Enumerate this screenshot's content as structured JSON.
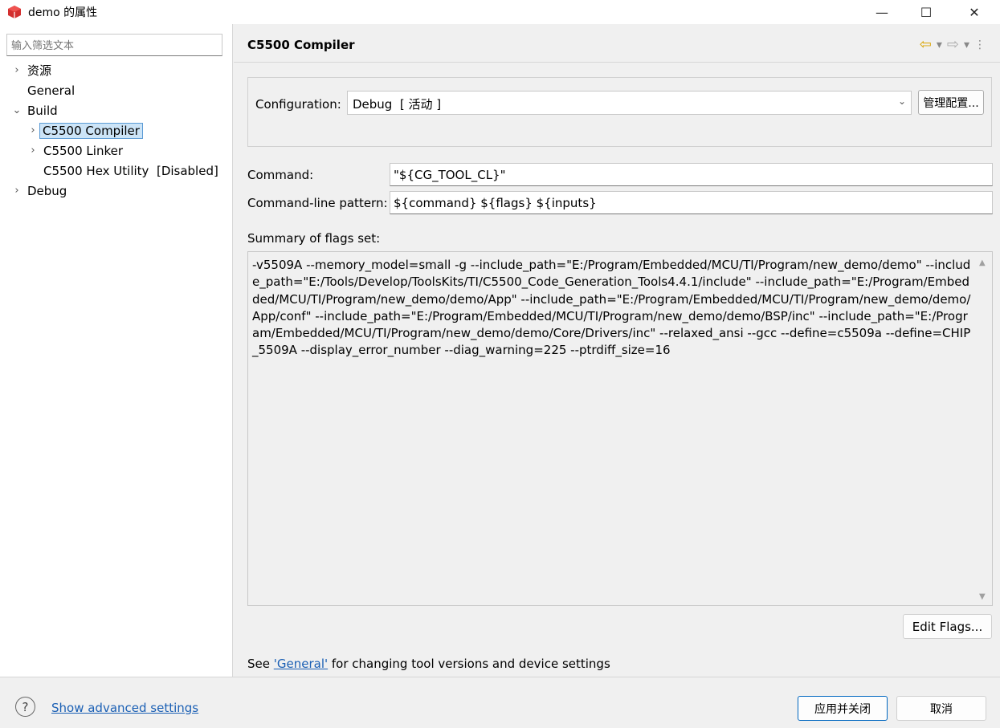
{
  "window": {
    "title": "demo 的属性",
    "minimize": "—",
    "maximize": "☐",
    "close": "✕"
  },
  "sidebar": {
    "filter_placeholder": "输入筛选文本",
    "items": [
      {
        "label": "资源"
      },
      {
        "label": "General"
      },
      {
        "label": "Build"
      },
      {
        "label": "C5500 Compiler"
      },
      {
        "label": "C5500 Linker"
      },
      {
        "label": "C5500 Hex Utility  [Disabled]"
      },
      {
        "label": "Debug"
      }
    ]
  },
  "main": {
    "title": "C5500 Compiler",
    "configuration_label": "Configuration:",
    "configuration_value": "Debug  [ 活动 ]",
    "manage_button": "管理配置...",
    "command_label": "Command:",
    "command_value": "\"${CG_TOOL_CL}\"",
    "pattern_label": "Command-line pattern:",
    "pattern_value": "${command} ${flags} ${inputs}",
    "summary_label": "Summary of flags set:",
    "summary_text": "-v5509A --memory_model=small -g --include_path=\"E:/Program/Embedded/MCU/TI/Program/new_demo/demo\" --include_path=\"E:/Tools/Develop/ToolsKits/TI/C5500_Code_Generation_Tools4.4.1/include\" --include_path=\"E:/Program/Embedded/MCU/TI/Program/new_demo/demo/App\" --include_path=\"E:/Program/Embedded/MCU/TI/Program/new_demo/demo/App/conf\" --include_path=\"E:/Program/Embedded/MCU/TI/Program/new_demo/demo/BSP/inc\" --include_path=\"E:/Program/Embedded/MCU/TI/Program/new_demo/demo/Core/Drivers/inc\" --relaxed_ansi --gcc --define=c5509a --define=CHIP_5509A --display_error_number --diag_warning=225 --ptrdiff_size=16",
    "edit_flags_button": "Edit Flags...",
    "see_prefix": "See ",
    "see_link": "'General'",
    "see_suffix": " for changing tool versions and device settings"
  },
  "footer": {
    "help_icon": "?",
    "advanced_link": "Show advanced settings",
    "apply_button": "应用并关闭",
    "cancel_button": "取消"
  },
  "colors": {
    "accent": "#0067c0",
    "link": "#1a5fb4",
    "selection": "#cce4f7"
  }
}
